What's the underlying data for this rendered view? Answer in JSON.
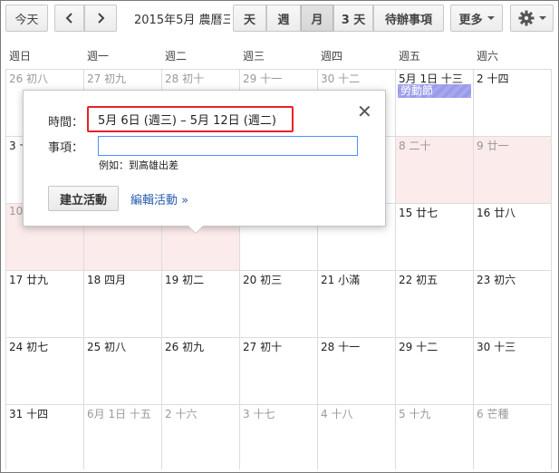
{
  "toolbar": {
    "today": "今天",
    "prev_icon": "chevron-left-icon",
    "next_icon": "chevron-right-icon",
    "date_range": "2015年5月 農曆三",
    "views": [
      "天",
      "週",
      "月",
      "3 天",
      "待辦事項"
    ],
    "active_view": "月",
    "more": "更多",
    "settings_icon": "gear-icon"
  },
  "weekdays": [
    "週日",
    "週一",
    "週二",
    "週三",
    "週四",
    "週五",
    "週六"
  ],
  "weeks": [
    [
      "26 初八",
      "27 初九",
      "28 初十",
      "29 十一",
      "30 十二",
      "5月 1日 十三",
      "2 十四"
    ],
    [
      "3 十",
      "",
      "",
      "",
      "",
      "8 二十",
      "9 廿一"
    ],
    [
      "10",
      "",
      "",
      "",
      "",
      "15 廿七",
      "16 廿八"
    ],
    [
      "17 廿九",
      "18 四月",
      "19 初二",
      "20 初三",
      "21 小滿",
      "22 初五",
      "23 初六"
    ],
    [
      "24 初七",
      "25 初八",
      "26 初九",
      "27 初十",
      "28 十一",
      "29 十二",
      "30 十三"
    ],
    [
      "31 十四",
      "6月 1日 十五",
      "2 十六",
      "3 十七",
      "4 十八",
      "5 十九",
      "6 芒種"
    ]
  ],
  "event": {
    "label": "勞動節",
    "color": "#a7a7f0"
  },
  "popup": {
    "time_label": "時間：",
    "time_value": "5月 6日 (週三) – 5月 12日 (週二)",
    "title_label": "事項：",
    "title_value": "",
    "hint": "例如：到高雄出差",
    "create_button": "建立活動",
    "edit_link": "編輯活動 »",
    "close_icon": "close-icon"
  },
  "colors": {
    "selection": "#fcebeb",
    "highlight_border": "#e8202a",
    "link": "#2a5db0"
  }
}
